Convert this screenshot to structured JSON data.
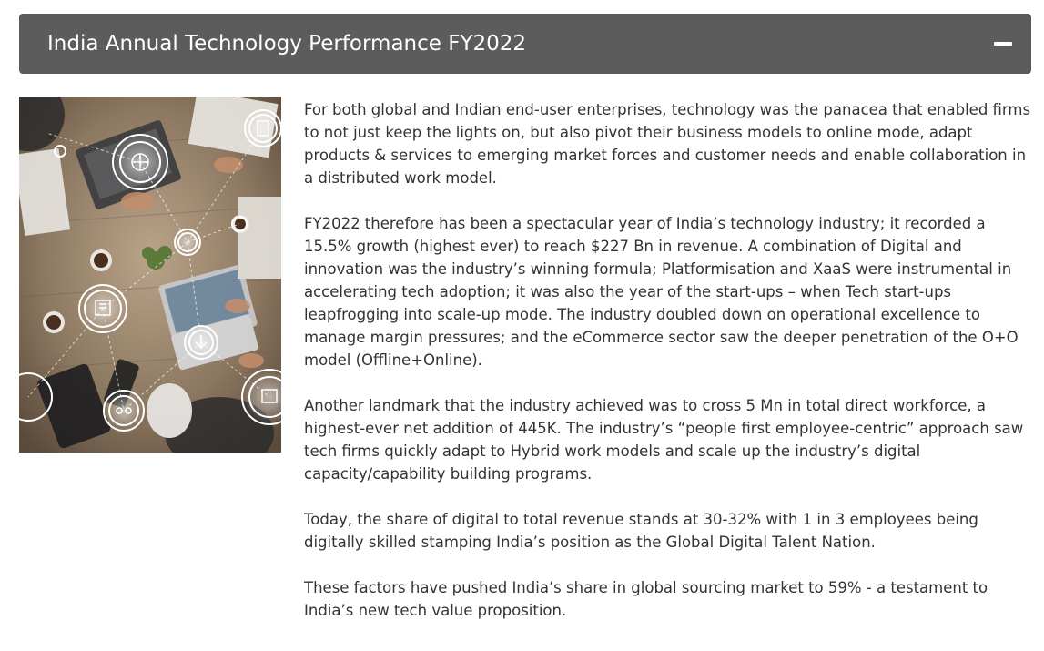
{
  "section": {
    "title": "India Annual Technology Performance FY2022",
    "icon": "minus-icon"
  },
  "image": {
    "description_icon": "technology-teamwork-image"
  },
  "paragraphs": [
    "For both global and Indian end-user enterprises, technology was the panacea that enabled firms to not just keep the lights on, but also pivot their business models to online mode, adapt products & services to emerging market forces and customer needs and enable collaboration in a distributed work model.",
    "FY2022 therefore has been a spectacular year of India’s technology industry; it recorded a 15.5% growth (highest ever) to reach $227 Bn in revenue. A combination of Digital and innovation was the industry’s winning formula; Platformisation and XaaS were instrumental in accelerating tech adoption; it was also the year of the start-ups – when Tech start-ups leapfrogging into scale-up mode. The industry doubled down on operational excellence to manage margin pressures; and the eCommerce sector saw the deeper penetration of the O+O model (Offline+Online).",
    "Another landmark that the industry achieved was to cross 5 Mn in total direct workforce, a highest-ever net addition of 445K. The industry’s “people first employee-centric” approach saw tech firms quickly adapt to Hybrid work models and scale up the industry’s digital capacity/capability building programs.",
    "Today, the share of digital to total revenue stands at 30-32% with 1 in 3 employees being digitally skilled stamping India’s position as the Global Digital Talent Nation.",
    "These factors have pushed India’s share in global sourcing market to 59% - a testament to India’s new tech value proposition."
  ],
  "colors": {
    "header_bg": "#5c5c5c",
    "header_text": "#ffffff",
    "body_text": "#333333"
  }
}
